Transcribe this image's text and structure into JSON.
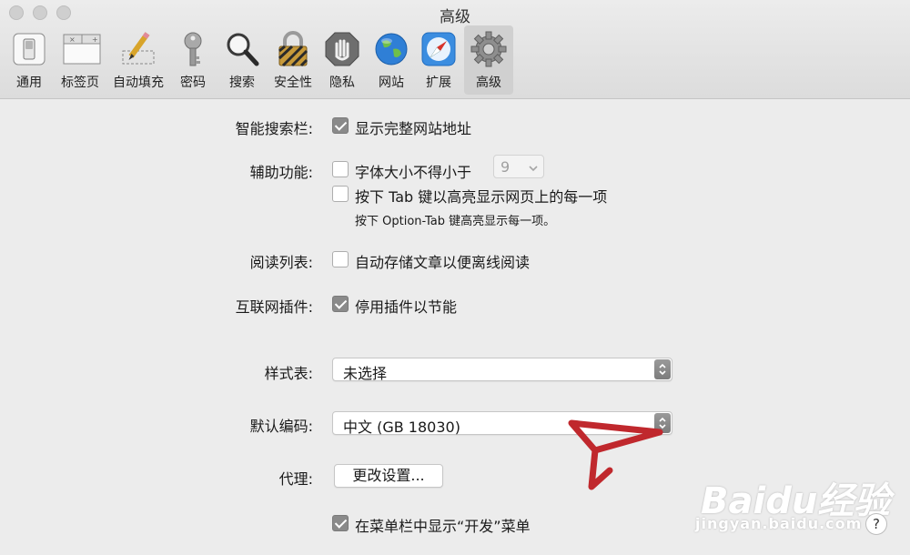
{
  "window": {
    "title": "高级"
  },
  "toolbar": [
    {
      "label": "通用",
      "icon": "general-switch-icon",
      "selected": false
    },
    {
      "label": "标签页",
      "icon": "tabs-icon",
      "selected": false
    },
    {
      "label": "自动填充",
      "icon": "pencil-form-icon",
      "selected": false
    },
    {
      "label": "密码",
      "icon": "key-icon",
      "selected": false
    },
    {
      "label": "搜索",
      "icon": "magnifier-icon",
      "selected": false
    },
    {
      "label": "安全性",
      "icon": "padlock-icon",
      "selected": false
    },
    {
      "label": "隐私",
      "icon": "hand-stop-icon",
      "selected": false
    },
    {
      "label": "网站",
      "icon": "globe-icon",
      "selected": false
    },
    {
      "label": "扩展",
      "icon": "compass-icon",
      "selected": false
    },
    {
      "label": "高级",
      "icon": "gear-icon",
      "selected": true
    }
  ],
  "settings": {
    "smart_search": {
      "label": "智能搜索栏:",
      "option": "显示完整网站地址",
      "checked": true
    },
    "accessibility": {
      "label": "辅助功能:",
      "min_font_option": "字体大小不得小于",
      "min_font_checked": false,
      "min_font_value": "9",
      "tab_option": "按下 Tab 键以高亮显示网页上的每一项",
      "tab_checked": false,
      "tab_note": "按下 Option-Tab 键高亮显示每一项。"
    },
    "reading_list": {
      "label": "阅读列表:",
      "option": "自动存储文章以便离线阅读",
      "checked": false
    },
    "plugins": {
      "label": "互联网插件:",
      "option": "停用插件以节能",
      "checked": true
    },
    "stylesheet": {
      "label": "样式表:",
      "value": "未选择"
    },
    "encoding": {
      "label": "默认编码:",
      "value": "中文 (GB 18030)"
    },
    "proxy": {
      "label": "代理:",
      "button": "更改设置..."
    },
    "develop_menu": {
      "option": "在菜单栏中显示“开发”菜单",
      "checked": true
    }
  },
  "help": {
    "label": "?"
  },
  "watermark": {
    "brand": "Baidu经验",
    "url": "jingyan.baidu.com"
  },
  "colors": {
    "annotation_arrow": "#c0282d",
    "checkbox_checked": "#8a8a8a",
    "toolbar_selected": "#d0d0d0"
  }
}
